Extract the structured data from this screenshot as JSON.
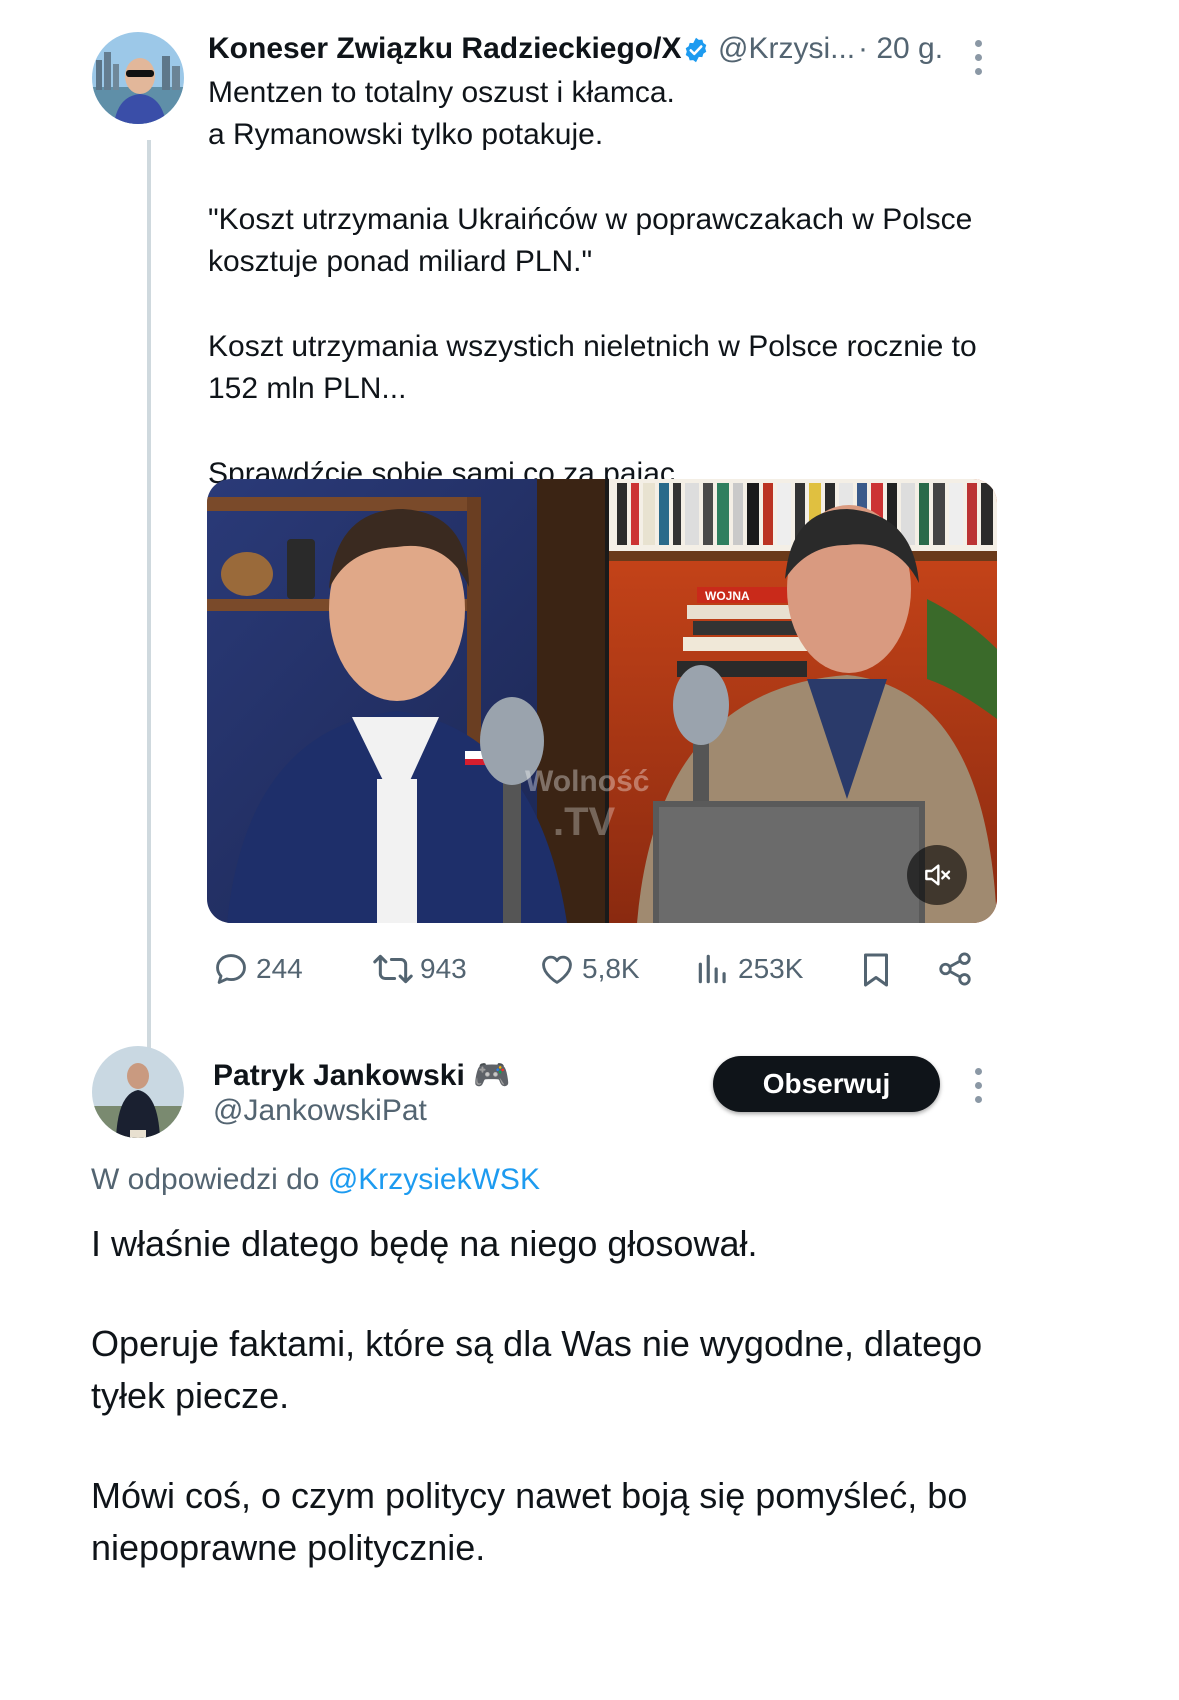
{
  "original_tweet": {
    "author_name": "Koneser Związku Radzieckiego/X",
    "verified": true,
    "handle": "@Krzysi...",
    "time": "· 20 g.",
    "paragraphs": [
      "Mentzen to totalny oszust i kłamca.\na Rymanowski tylko potakuje.",
      "\"Koszt utrzymania Ukraińców w poprawczakach w Polsce\nkosztuje ponad miliard PLN.\"",
      "Koszt utrzymania wszystich nieletnich w Polsce rocznie to\n152 mln PLN...",
      "Sprawdźcie sobie sami co za pajac."
    ],
    "video": {
      "watermark_line1": "Wolność",
      "watermark_line2": ".TV",
      "book_title": "WOJNA",
      "mute_icon": "speaker-muted-icon"
    },
    "stats": {
      "replies": "244",
      "reposts": "943",
      "likes": "5,8K",
      "views": "253K"
    }
  },
  "reply_tweet": {
    "author_name": "Patryk Jankowski",
    "author_emoji": "🎮",
    "handle": "@JankowskiPat",
    "follow_label": "Obserwuj",
    "in_reply_to_prefix": "W odpowiedzi do",
    "in_reply_to_handle": "@KrzysiekWSK",
    "paragraphs": [
      "I właśnie dlatego będę na niego głosował.",
      "Operuje faktami, które są dla Was nie wygodne, dlatego\ntyłek piecze.",
      "Mówi coś, o czym politycy nawet boją się pomyśleć, bo\nniepoprawne politycznie."
    ]
  },
  "colors": {
    "accent": "#1d9bf0",
    "text": "#0f1419",
    "secondary": "#536471",
    "button_bg": "#0f1419"
  }
}
